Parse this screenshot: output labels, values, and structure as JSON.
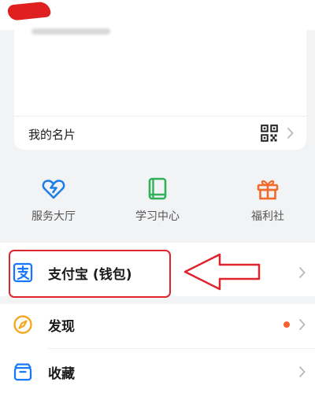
{
  "header": {
    "redacted_name": "(redacted)"
  },
  "card": {
    "label": "我的名片",
    "icon": "qr-code-icon"
  },
  "features": [
    {
      "label": "服务大厅",
      "icon": "heart-service-icon",
      "color": "#1e7ee8"
    },
    {
      "label": "学习中心",
      "icon": "book-icon",
      "color": "#2fb15a"
    },
    {
      "label": "福利社",
      "icon": "gift-icon",
      "color": "#f26a2e"
    }
  ],
  "menu": [
    {
      "label": "支付宝 (钱包)",
      "icon": "alipay-icon",
      "color": "#1677ff"
    },
    {
      "label": "发现",
      "icon": "compass-icon",
      "color": "#f5a623",
      "has_notification_dot": true
    },
    {
      "label": "收藏",
      "icon": "box-icon",
      "color": "#1677ff"
    }
  ],
  "annotation": {
    "highlight_color": "#e0242d",
    "target": "支付宝 (钱包)"
  }
}
